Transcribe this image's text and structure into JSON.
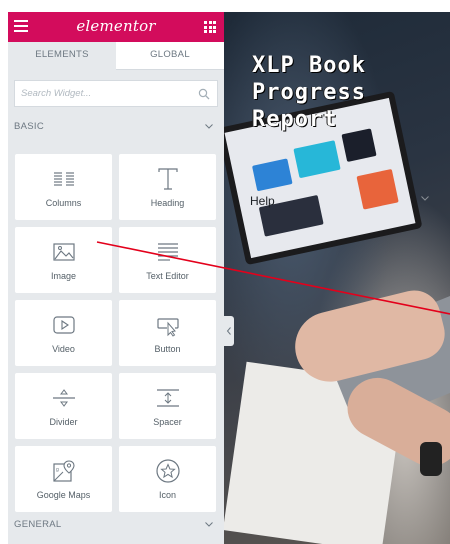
{
  "app": {
    "brand": "elementor"
  },
  "tabs": [
    {
      "label": "ELEMENTS",
      "active": true
    },
    {
      "label": "GLOBAL",
      "active": false
    }
  ],
  "search": {
    "placeholder": "Search Widget...",
    "value": ""
  },
  "sections": {
    "basic": "BASIC",
    "general": "GENERAL"
  },
  "widgets": [
    {
      "label": "Columns",
      "icon": "columns-icon"
    },
    {
      "label": "Heading",
      "icon": "heading-icon"
    },
    {
      "label": "Image",
      "icon": "image-icon"
    },
    {
      "label": "Text Editor",
      "icon": "text-editor-icon"
    },
    {
      "label": "Video",
      "icon": "video-icon"
    },
    {
      "label": "Button",
      "icon": "button-icon"
    },
    {
      "label": "Divider",
      "icon": "divider-icon"
    },
    {
      "label": "Spacer",
      "icon": "spacer-icon"
    },
    {
      "label": "Google Maps",
      "icon": "google-maps-icon"
    },
    {
      "label": "Icon",
      "icon": "star-icon"
    }
  ],
  "preview": {
    "title": "XLP Book Progress Report",
    "help": "Help"
  },
  "colors": {
    "accent": "#d30c5c",
    "panel_bg": "#e6e9ec",
    "annotation_line": "#e3001b"
  }
}
